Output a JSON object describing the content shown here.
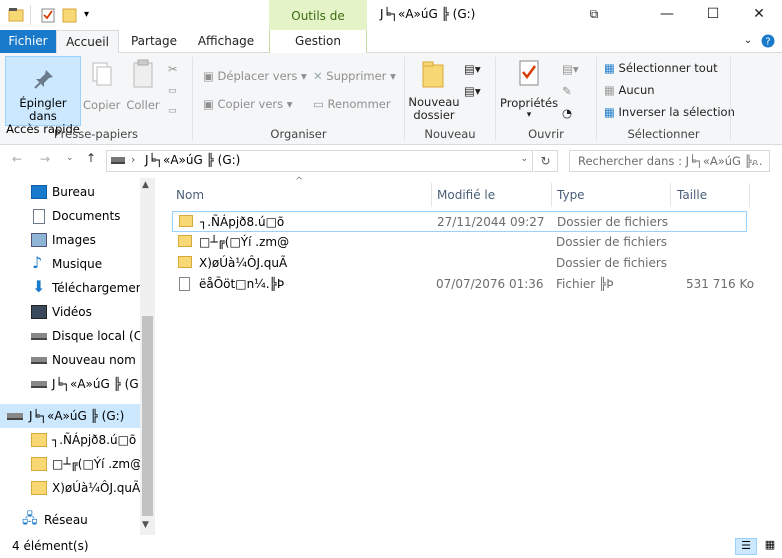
{
  "window": {
    "title": "J╘┐«A»úG ╠ (G:)",
    "context_tab": "Outils de lecteur",
    "context_subtab": "Gestion"
  },
  "tabs": [
    "Fichier",
    "Accueil",
    "Partage",
    "Affichage"
  ],
  "ribbon": {
    "pin": "Épingler dans Accès rapide",
    "pin_line1": "Épingler dans",
    "pin_line2": "Accès rapide",
    "copy": "Copier",
    "paste": "Coller",
    "move_to": "Déplacer vers",
    "copy_to": "Copier vers",
    "delete": "Supprimer",
    "rename": "Renommer",
    "new_folder_line1": "Nouveau",
    "new_folder_line2": "dossier",
    "properties": "Propriétés",
    "select_all": "Sélectionner tout",
    "select_none": "Aucun",
    "invert": "Inverser la sélection",
    "groups": [
      "Presse-papiers",
      "Organiser",
      "Nouveau",
      "Ouvrir",
      "Sélectionner"
    ]
  },
  "address": {
    "path": "J╘┐«A»úG ╠ (G:)",
    "search_placeholder": "Rechercher dans : J╘┐«A»úG ╠..."
  },
  "nav": [
    {
      "label": "Bureau",
      "icon": "desktop-icon"
    },
    {
      "label": "Documents",
      "icon": "documents-icon"
    },
    {
      "label": "Images",
      "icon": "images-icon"
    },
    {
      "label": "Musique",
      "icon": "music-icon"
    },
    {
      "label": "Téléchargements",
      "icon": "download-icon"
    },
    {
      "label": "Vidéos",
      "icon": "videos-icon"
    },
    {
      "label": "Disque local (C:)",
      "icon": "drive-icon"
    },
    {
      "label": "Nouveau nom (I",
      "icon": "drive-icon"
    },
    {
      "label": "J╘┐«A»úG ╠ (G:)",
      "icon": "drive-icon"
    },
    {
      "label": "J╘┐«A»úG ╠ (G:)",
      "icon": "drive-icon"
    },
    {
      "label": "┐.ÑÁpjð8.ú□õ",
      "icon": "folder-icon"
    },
    {
      "label": "□┴╔(□Ýí .zm@",
      "icon": "folder-icon"
    },
    {
      "label": "X)øÚà¼ÔJ.quÃ",
      "icon": "folder-icon"
    },
    {
      "label": "Réseau",
      "icon": "network-icon"
    }
  ],
  "columns": [
    "Nom",
    "Modifié le",
    "Type",
    "Taille"
  ],
  "files": [
    {
      "name": "┐.ÑÁpjð8.ú□õ",
      "date": "27/11/2044 09:27",
      "type": "Dossier de fichiers",
      "size": "",
      "icon": "folder-icon"
    },
    {
      "name": "□┴╔(□Ýí .zm@",
      "date": "",
      "type": "Dossier de fichiers",
      "size": "",
      "icon": "folder-icon"
    },
    {
      "name": "X)øÚà¼ÔJ.quÃ",
      "date": "",
      "type": "Dossier de fichiers",
      "size": "",
      "icon": "folder-icon"
    },
    {
      "name": "ëåÕöt□n¼.╠Þ",
      "date": "07/07/2076 01:36",
      "type": "Fichier ╠Þ",
      "size": "531 716 Ko",
      "icon": "file-icon"
    }
  ],
  "status": {
    "count": "4 élément(s)"
  },
  "colors": {
    "accent": "#1979ca",
    "selection": "#cce8ff",
    "folder": "#f8d775"
  }
}
